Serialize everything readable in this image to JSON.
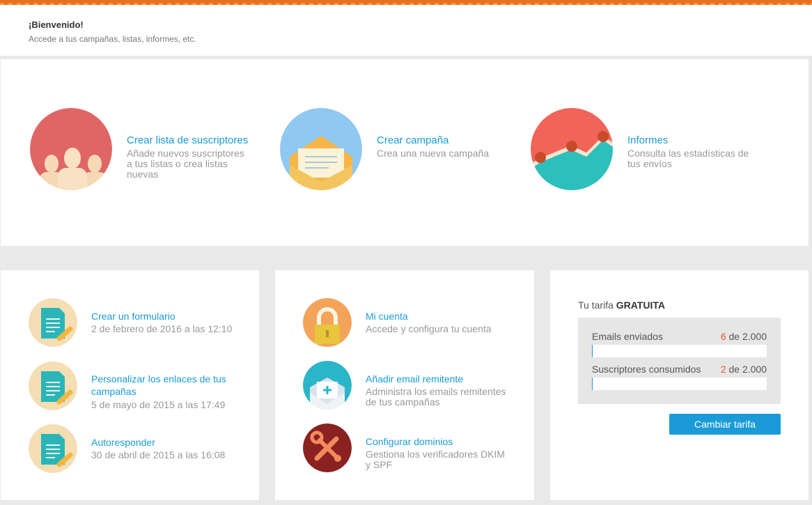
{
  "welcome": {
    "title": "¡Bienvenido!",
    "subtitle": "Accede a tus campañas, listas, informes, etc."
  },
  "hero": [
    {
      "title": "Crear lista de suscriptores",
      "description": "Añade nuevos suscriptores a tus listas o crea listas nuevas",
      "icon": "subscribers-icon",
      "color": "#e06666"
    },
    {
      "title": "Crear campaña",
      "description": "Crea una nueva campaña",
      "icon": "envelope-icon",
      "color": "#8fc8f0"
    },
    {
      "title": "Informes",
      "description": "Consulta las estadísticas de tus envíos",
      "icon": "reports-chart-icon",
      "color": "#f0645a"
    }
  ],
  "activity": [
    {
      "title": "Crear un formulario",
      "description": "2 de febrero de 2016 a las 12:10",
      "icon": "form-document-icon"
    },
    {
      "title": "Personalizar los enlaces de tus campañas",
      "description": "5 de mayo de 2015 a las 17:49",
      "icon": "form-document-icon"
    },
    {
      "title": "Autoresponder",
      "description": "30 de abril de 2015 a las 16:08",
      "icon": "form-document-icon"
    }
  ],
  "account": [
    {
      "title": "Mi cuenta",
      "description": "Accede y configura tu cuenta",
      "icon": "padlock-icon"
    },
    {
      "title": "Añadir email remitente",
      "description": "Administra los emails remitentes de tus campañas",
      "icon": "add-sender-email-icon"
    },
    {
      "title": "Configurar dominios",
      "description": "Gestiona los verificadores DKIM y SPF",
      "icon": "tools-icon"
    }
  ],
  "plan": {
    "label": "Tu tarifa",
    "name": "GRATUITA",
    "stats": [
      {
        "label": "Emails enviados",
        "used": "6",
        "total": "de 2.000",
        "fraction": 0.003
      },
      {
        "label": "Suscriptores consumidos",
        "used": "2",
        "total": "de 2.000",
        "fraction": 0.001
      }
    ],
    "button": "Cambiar tarifa"
  },
  "colors": {
    "accent": "#1a9bd7",
    "brand": "#e8711f",
    "highlight": "#e2562c"
  }
}
